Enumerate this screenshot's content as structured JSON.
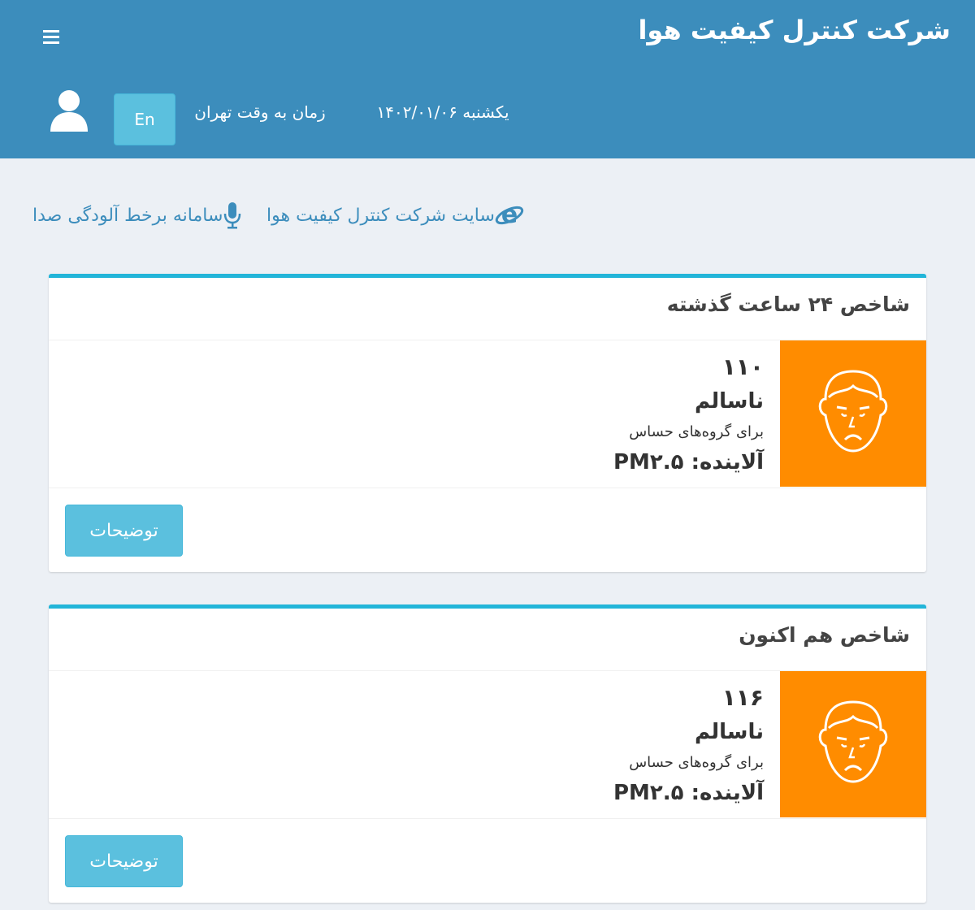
{
  "header": {
    "brand": "شرکت کنترل کیفیت هوا",
    "date": "یکشنبه ۱۴۰۲/۰۱/۰۶",
    "time_label": "زمان به وقت تهران",
    "lang_button": "En",
    "menu_icon": "hamburger-icon",
    "user_icon": "user-icon"
  },
  "links": [
    {
      "label": "سایت شرکت کنترل کیفیت هوا",
      "icon": "internet-explorer-icon"
    },
    {
      "label": "سامانه برخط آلودگی صدا",
      "icon": "microphone-icon"
    }
  ],
  "cards": [
    {
      "title": "شاخص ۲۴ ساعت گذشته",
      "aqi": "۱۱۰",
      "status": "ناسالم",
      "group": "برای گروه‌های حساس",
      "pollutant": "آلاینده: PM۲.۵",
      "button": "توضیحات",
      "face_icon": "sad-face-icon"
    },
    {
      "title": "شاخص هم اکنون",
      "aqi": "۱۱۶",
      "status": "ناسالم",
      "group": "برای گروه‌های حساس",
      "pollutant": "آلاینده: PM۲.۵",
      "button": "توضیحات",
      "face_icon": "sad-face-icon"
    }
  ],
  "colors": {
    "header_bg": "#3c8dbc",
    "accent_border": "#22b5d9",
    "aqi_unhealthy_sensitive": "#ff8c00",
    "button_info": "#5bc0de"
  }
}
